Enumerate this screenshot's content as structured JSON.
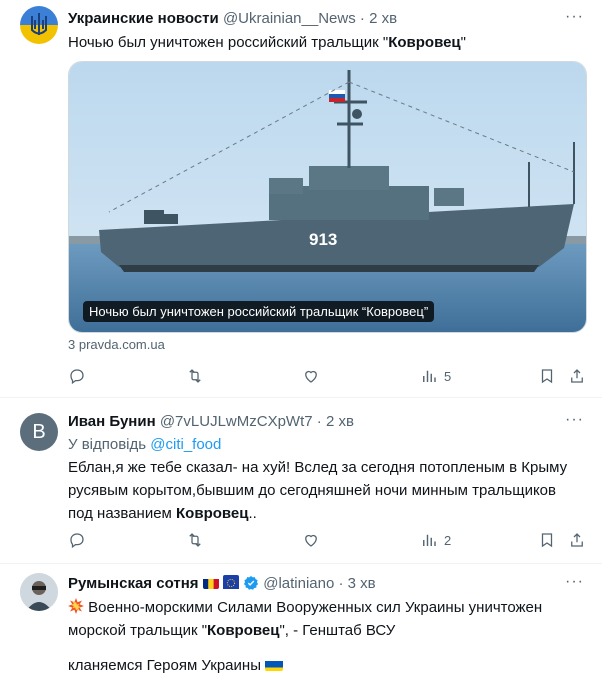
{
  "tweets": [
    {
      "name": "Украинские новости",
      "handle": "@Ukrainian__News",
      "time": "2 хв",
      "text_prefix": "Ночью был уничтожен российский тральщик \"",
      "text_bold": "Ковровец",
      "text_suffix": "\"",
      "media": {
        "caption": "Ночью был уничтожен российский тральщик “Ковровец”",
        "hull_number": "913"
      },
      "link_source": "3 pravda.com.ua",
      "views": "5"
    },
    {
      "avatar_letter": "В",
      "name": "Иван Бунин",
      "handle": "@7vLUJLwMzCXpWt7",
      "time": "2 хв",
      "reply_to_label": "У відповідь",
      "reply_to_handle": "@citi_food",
      "text_prefix": "Еблан,я же тебе сказал- на хуй! Вслед за сегодня потопленым в Крыму русявым корытом,бывшим до сегодняшней ночи минным тральщиков под названием ",
      "text_bold": "Ковровец",
      "text_suffix": "..",
      "views": "2"
    },
    {
      "name": "Румынская сотня",
      "handle": "@latiniano",
      "time": "3 хв",
      "text_prefix": " Военно-морскими Силами Вооруженных сил Украины уничтожен морской тральщик \"",
      "text_bold": "Ковровец",
      "text_suffix": "\", - Генштаб ВСУ",
      "text_line2": "кланяемся Героям Украины"
    }
  ],
  "dot": "·",
  "more": "···",
  "colors": {
    "accent": "#1d9bf0",
    "muted": "#536471",
    "text": "#0f1419"
  },
  "icons": [
    "reply-icon",
    "retweet-icon",
    "like-icon",
    "views-icon",
    "bookmark-icon",
    "share-icon",
    "verified-icon",
    "collision-emoji-icon"
  ]
}
